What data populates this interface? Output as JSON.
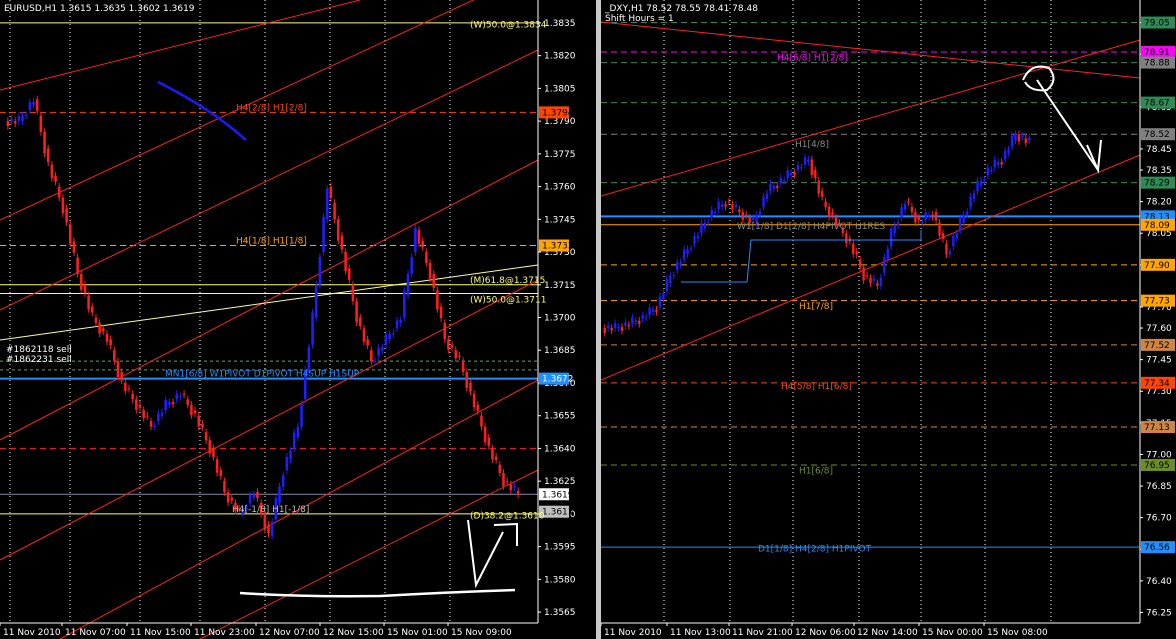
{
  "left_chart": {
    "header": "EURUSD,H1  1.3615 1.3635 1.3602 1.3619",
    "chart_data": {
      "type": "candlestick",
      "title": "EURUSD,H1",
      "ylim": [
        1.356,
        1.384
      ],
      "y_ticks": [
        1.3835,
        1.382,
        1.3805,
        1.379,
        1.3775,
        1.376,
        1.3745,
        1.373,
        1.3715,
        1.37,
        1.3685,
        1.367,
        1.3655,
        1.364,
        1.3625,
        1.361,
        1.3595,
        1.358,
        1.3565
      ],
      "x_ticks": [
        "11 Nov 2010",
        "11 Nov 07:00",
        "11 Nov 15:00",
        "11 Nov 23:00",
        "12 Nov 07:00",
        "12 Nov 15:00",
        "15 Nov 01:00",
        "15 Nov 09:00"
      ],
      "close_path": [
        1.379,
        1.38,
        1.377,
        1.375,
        1.372,
        1.37,
        1.369,
        1.367,
        1.366,
        1.365,
        1.366,
        1.3665,
        1.3655,
        1.364,
        1.362,
        1.361,
        1.362,
        1.36,
        1.363,
        1.365,
        1.37,
        1.376,
        1.373,
        1.37,
        1.368,
        1.369,
        1.37,
        1.374,
        1.372,
        1.369,
        1.368,
        1.366,
        1.364,
        1.3625,
        1.3619
      ]
    },
    "price_labels": [
      {
        "text": "1.3794",
        "value": 1.3794,
        "bg": "#ff4500",
        "fg": "#000000"
      },
      {
        "text": "1.3733",
        "value": 1.3733,
        "bg": "#ffa500",
        "fg": "#000000"
      },
      {
        "text": "1.3672",
        "value": 1.3672,
        "bg": "#1e90ff",
        "fg": "#ffffff"
      },
      {
        "text": "1.3619",
        "value": 1.3619,
        "bg": "#ffffff",
        "fg": "#000000"
      },
      {
        "text": "1.3611",
        "value": 1.3611,
        "bg": "#c0c0c0",
        "fg": "#000000"
      }
    ],
    "line_labels": {
      "h4_2_8": "H4[2/8] H1[2/8]",
      "h4_1_8": "H4[1/8] H1[1/8]",
      "mn1": "MN1[6/8] W1PIVOT D1PIVOT H4SUP H1SUP",
      "h4_m1_8": "H4[-1/8] H1[-1/8]",
      "fib_618": "(M)61.8@1.3715",
      "fib_50": "(W)50.0@1.3711",
      "fib_382": "(D)38.2@1.3610",
      "top_right": "(W)50.0@1.3834",
      "orders": [
        "#1862118 sell",
        "#1862231 sell"
      ]
    }
  },
  "right_chart": {
    "header": "_DXY,H1  78.52 78.55 78.41 78.48",
    "sub_header": "Shift Hours = 1",
    "chart_data": {
      "type": "candlestick",
      "title": "_DXY,H1",
      "ylim": [
        76.2,
        79.1
      ],
      "y_ticks": [
        79.05,
        78.9,
        78.65,
        78.45,
        78.35,
        78.2,
        78.05,
        77.9,
        77.7,
        77.6,
        77.45,
        77.3,
        77.15,
        77.0,
        76.85,
        76.7,
        76.55,
        76.4,
        76.25
      ],
      "x_ticks": [
        "11 Nov 2010",
        "11 Nov 13:00",
        "11 Nov 21:00",
        "12 Nov 06:00",
        "12 Nov 14:00",
        "15 Nov 00:00",
        "15 Nov 08:00"
      ],
      "close_path": [
        77.6,
        77.62,
        77.65,
        77.7,
        77.85,
        77.95,
        78.05,
        78.15,
        78.2,
        78.15,
        78.1,
        78.25,
        78.3,
        78.35,
        78.4,
        78.2,
        78.1,
        78.0,
        77.85,
        77.8,
        78.05,
        78.2,
        78.1,
        78.15,
        77.95,
        78.1,
        78.25,
        78.35,
        78.4,
        78.52,
        78.48
      ]
    },
    "price_labels": [
      {
        "text": "79.05",
        "value": 79.05,
        "bg": "#2e8b57",
        "fg": "#000000"
      },
      {
        "text": "78.91",
        "value": 78.91,
        "bg": "#ff00ff",
        "fg": "#000000"
      },
      {
        "text": "78.88",
        "value": 78.86,
        "bg": "#808080",
        "fg": "#000000"
      },
      {
        "text": "78.67",
        "value": 78.67,
        "bg": "#2e8b57",
        "fg": "#000000"
      },
      {
        "text": "78.52",
        "value": 78.52,
        "bg": "#808080",
        "fg": "#000000"
      },
      {
        "text": "78.29",
        "value": 78.29,
        "bg": "#2e8b57",
        "fg": "#000000"
      },
      {
        "text": "78.13",
        "value": 78.13,
        "bg": "#1e90ff",
        "fg": "#000000"
      },
      {
        "text": "78.09",
        "value": 78.09,
        "bg": "#ffa500",
        "fg": "#000000"
      },
      {
        "text": "77.90",
        "value": 77.9,
        "bg": "#ffa500",
        "fg": "#000000"
      },
      {
        "text": "77.73",
        "value": 77.73,
        "bg": "#ffa500",
        "fg": "#000000"
      },
      {
        "text": "77.52",
        "value": 77.52,
        "bg": "#cd853f",
        "fg": "#000000"
      },
      {
        "text": "77.34",
        "value": 77.34,
        "bg": "#ff4500",
        "fg": "#000000"
      },
      {
        "text": "77.13",
        "value": 77.13,
        "bg": "#cd853f",
        "fg": "#000000"
      },
      {
        "text": "76.95",
        "value": 76.95,
        "bg": "#6b8e23",
        "fg": "#000000"
      },
      {
        "text": "76.56",
        "value": 76.56,
        "bg": "#1e90ff",
        "fg": "#000000"
      }
    ],
    "line_labels": {
      "h4_6_8": "H4[6/8] H1[2/8]",
      "h1_4_8": "H1[4/8]",
      "w1": "W1[1/8] D1[2/8] H4PIVOT H1RES",
      "h1_7_8": "H1[7/8]",
      "h4_5_8": "H4[5/8] H1[6/8]",
      "h1_6_8": "H1[6/8]",
      "d1": "D1[1/8] H4[2/8] H1PIVOT"
    }
  }
}
